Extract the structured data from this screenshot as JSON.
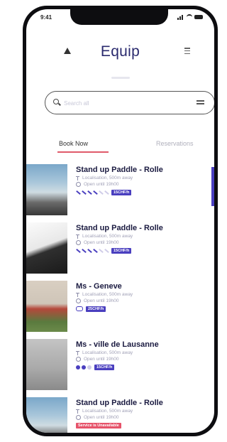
{
  "status_bar": {
    "time": "9:41"
  },
  "header": {
    "title": "Equip"
  },
  "search": {
    "placeholder": "Search all",
    "filter_icon": "filter-icon"
  },
  "tabs": [
    {
      "label": "Book Now",
      "active": true
    },
    {
      "label": "Reservations",
      "active": false
    }
  ],
  "items": [
    {
      "name": "Stand up Paddle - Rolle",
      "location": "Localisation, 500m away",
      "hours": "Open until 19h00",
      "price": "15CHF/h"
    },
    {
      "name": "Stand up Paddle - Rolle",
      "location": "Localisation, 500m away",
      "hours": "Open until 19h00",
      "price": "15CHF/h"
    },
    {
      "name": "Ms - Geneve",
      "location": "Localisation, 500m away",
      "hours": "Open until 19h00",
      "price": "25CHF/h"
    },
    {
      "name": "Ms - ville de Lausanne",
      "location": "Localisation, 500m away",
      "hours": "Open until 19h00",
      "price": "15CHF/h"
    },
    {
      "name": "Stand up Paddle - Rolle",
      "location": "Localisation, 500m away",
      "hours": "Open until 19h00",
      "price": "Service is Unavailable"
    }
  ],
  "colors": {
    "accent": "#4a3fbf",
    "alert": "#e6536a",
    "title": "#2a2a6e"
  }
}
